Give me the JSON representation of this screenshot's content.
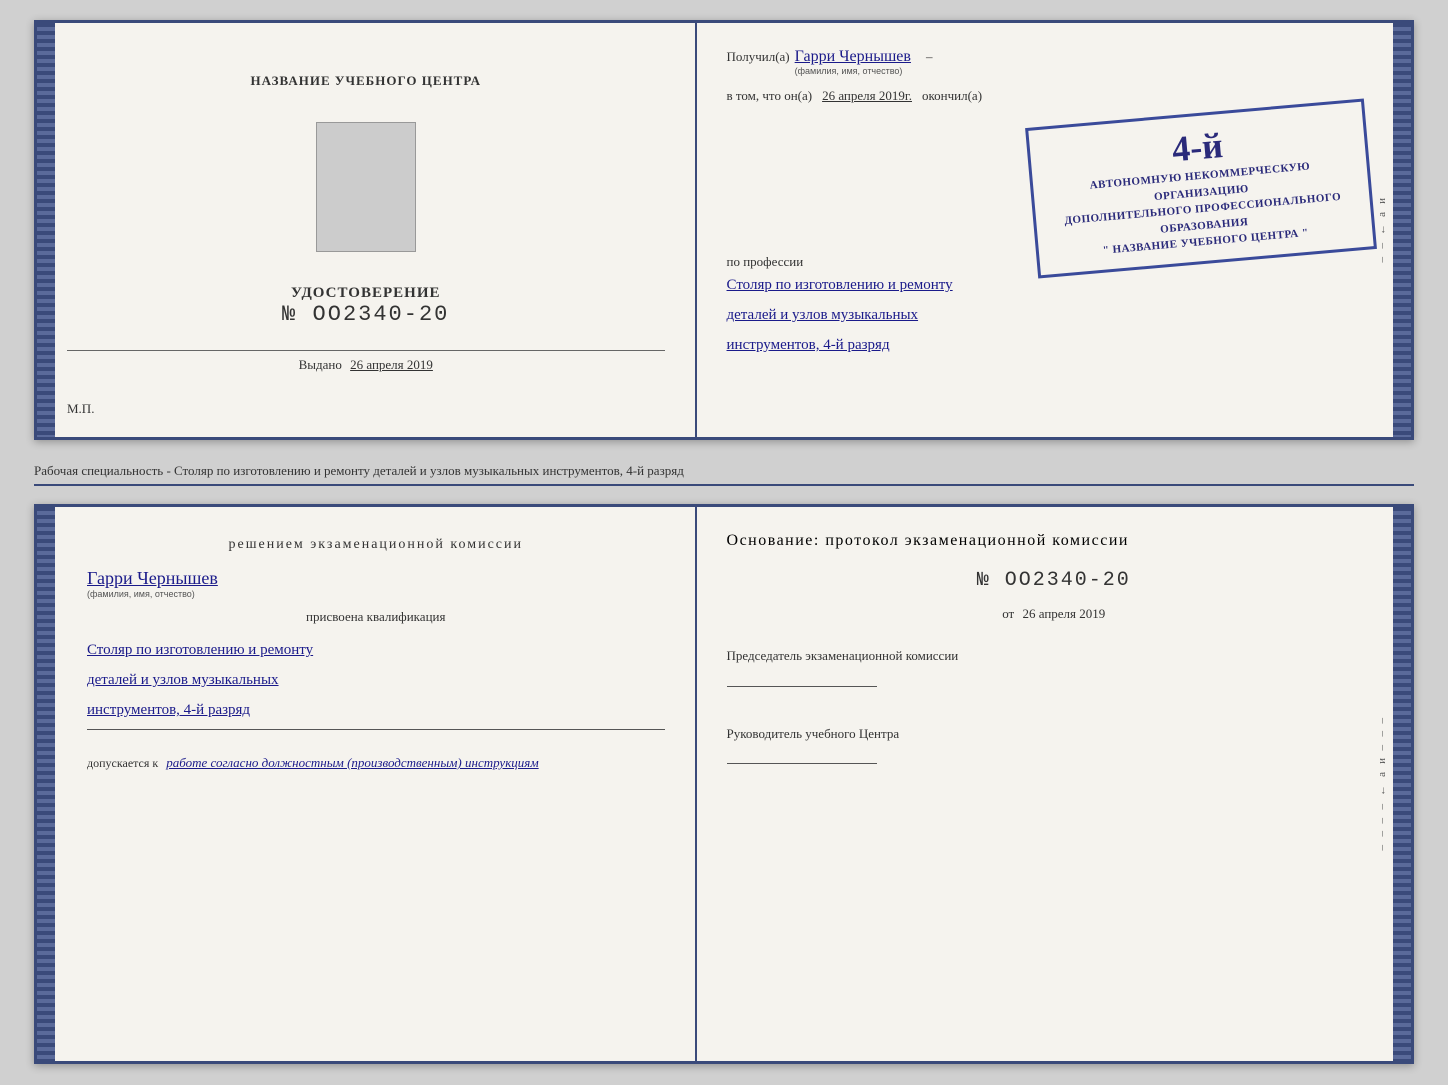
{
  "top_doc": {
    "left": {
      "center_title": "НАЗВАНИЕ УЧЕБНОГО ЦЕНТРА",
      "photo_alt": "фото",
      "udostoverenie_label": "УДОСТОВЕРЕНИЕ",
      "number_prefix": "№",
      "number": "OO2340-20",
      "vydano_label": "Выдано",
      "vydano_date": "26 апреля 2019",
      "mp_label": "М.П."
    },
    "right": {
      "poluchil_label": "Получил(а)",
      "recipient_name": "Гарри Чернышев",
      "recipient_sub": "(фамилия, имя, отчество)",
      "dash": "–",
      "vtom_label": "в том, что он(а)",
      "vtom_date": "26 апреля 2019г.",
      "okonchil_label": "окончил(а)",
      "stamp_number": "4-й",
      "stamp_line1": "АВТОНОМНУЮ НЕКОММЕРЧЕСКУЮ ОРГАНИЗАЦИЮ",
      "stamp_line2": "ДОПОЛНИТЕЛЬНОГО ПРОФЕССИОНАЛЬНОГО ОБРАЗОВАНИЯ",
      "stamp_line3": "\" НАЗВАНИЕ УЧЕБНОГО ЦЕНТРА \"",
      "po_professii_label": "по профессии",
      "profession_line1": "Столяр по изготовлению и ремонту",
      "profession_line2": "деталей и узлов музыкальных",
      "profession_line3": "инструментов, 4-й разряд"
    }
  },
  "separator": {
    "text": "Рабочая специальность - Столяр по изготовлению и ремонту деталей и узлов музыкальных инструментов, 4-й разряд"
  },
  "bottom_doc": {
    "left": {
      "resheniem_label": "Решением экзаменационной комиссии",
      "name": "Гарри Чернышев",
      "name_sub": "(фамилия, имя, отчество)",
      "prisvoena_label": "присвоена квалификация",
      "qualification_line1": "Столяр по изготовлению и ремонту",
      "qualification_line2": "деталей и узлов музыкальных",
      "qualification_line3": "инструментов, 4-й разряд",
      "dopuskaetsya_label": "допускается к",
      "dopuskaetsya_value": "работе согласно должностным (производственным) инструкциям"
    },
    "right": {
      "osnovanie_label": "Основание: протокол экзаменационной комиссии",
      "number_prefix": "№",
      "number": "OO2340-20",
      "ot_prefix": "от",
      "ot_date": "26 апреля 2019",
      "predsedatel_label": "Председатель экзаменационной комиссии",
      "rukovoditel_label": "Руководитель учебного Центра"
    },
    "side_chars": [
      "и",
      "а",
      "←",
      "–",
      "–",
      "–",
      "–"
    ]
  }
}
